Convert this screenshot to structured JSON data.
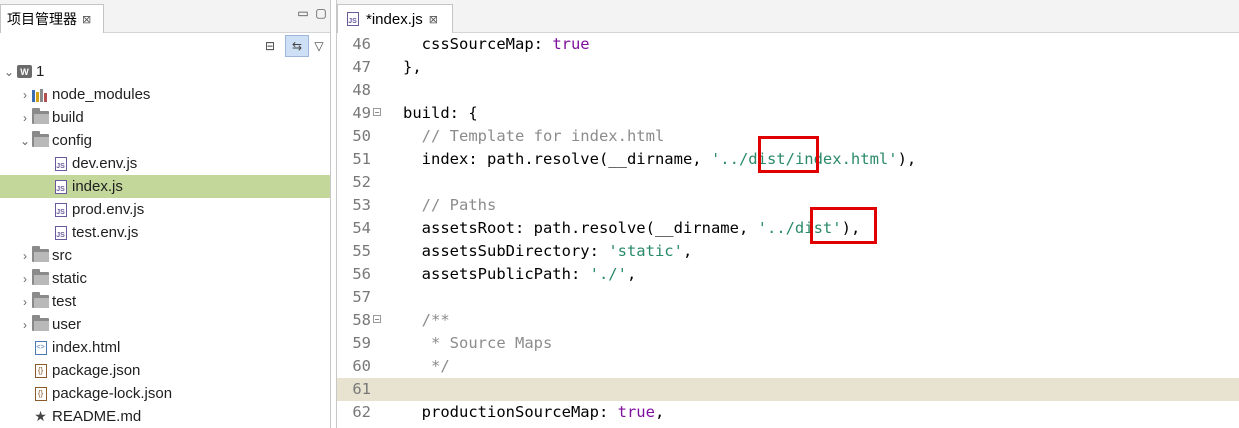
{
  "explorer": {
    "tab_title": "项目管理器",
    "close_glyph": "⊠",
    "minimize_glyph": "▭",
    "maximize_glyph": "▢",
    "collapse_glyph": "⊟",
    "link_glyph": "⇆",
    "menu_glyph": "▽",
    "tree": [
      {
        "label": "1",
        "icon": "project-icon",
        "twisty": "⌄"
      },
      {
        "label": "node_modules",
        "icon": "library-folder-icon",
        "twisty": "›"
      },
      {
        "label": "build",
        "icon": "folder-icon",
        "twisty": "›"
      },
      {
        "label": "config",
        "icon": "folder-icon",
        "twisty": "⌄"
      },
      {
        "label": "dev.env.js",
        "icon": "js-file-icon"
      },
      {
        "label": "index.js",
        "icon": "js-file-icon",
        "selected": true
      },
      {
        "label": "prod.env.js",
        "icon": "js-file-icon"
      },
      {
        "label": "test.env.js",
        "icon": "js-file-icon"
      },
      {
        "label": "src",
        "icon": "folder-icon",
        "twisty": "›"
      },
      {
        "label": "static",
        "icon": "folder-icon",
        "twisty": "›"
      },
      {
        "label": "test",
        "icon": "folder-icon",
        "twisty": "›"
      },
      {
        "label": "user",
        "icon": "folder-icon",
        "twisty": "›"
      },
      {
        "label": "index.html",
        "icon": "html-file-icon"
      },
      {
        "label": "package.json",
        "icon": "json-file-icon"
      },
      {
        "label": "package-lock.json",
        "icon": "json-file-icon"
      },
      {
        "label": "README.md",
        "icon": "star-icon"
      }
    ]
  },
  "editor": {
    "tab_title": "*index.js",
    "close_glyph": "⊠",
    "lines": [
      {
        "num": "46",
        "text": "  cssSourceMap: true"
      },
      {
        "num": "47",
        "text": "},"
      },
      {
        "num": "48",
        "text": ""
      },
      {
        "num": "49",
        "text": "build: {",
        "fold": "−"
      },
      {
        "num": "50",
        "text": "  // Template for index.html"
      },
      {
        "num": "51",
        "text": "  index: path.resolve(__dirname, '../dist/index.html'),"
      },
      {
        "num": "52",
        "text": ""
      },
      {
        "num": "53",
        "text": "  // Paths"
      },
      {
        "num": "54",
        "text": "  assetsRoot: path.resolve(__dirname, '../dist'),"
      },
      {
        "num": "55",
        "text": "  assetsSubDirectory: 'static',"
      },
      {
        "num": "56",
        "text": "  assetsPublicPath: './',"
      },
      {
        "num": "57",
        "text": ""
      },
      {
        "num": "58",
        "text": "  /**",
        "fold": "−"
      },
      {
        "num": "59",
        "text": "   * Source Maps"
      },
      {
        "num": "60",
        "text": "   */"
      },
      {
        "num": "61",
        "text": "",
        "current": true
      },
      {
        "num": "62",
        "text": "  productionSourceMap: true,"
      }
    ]
  },
  "colors": {
    "keyword": "#7f0f9e",
    "string": "#2a8a6a",
    "comment": "#8c8c8c",
    "selection": "#c4d79b",
    "current_line": "#e8e2d0",
    "highlight_box": "#e00000"
  }
}
